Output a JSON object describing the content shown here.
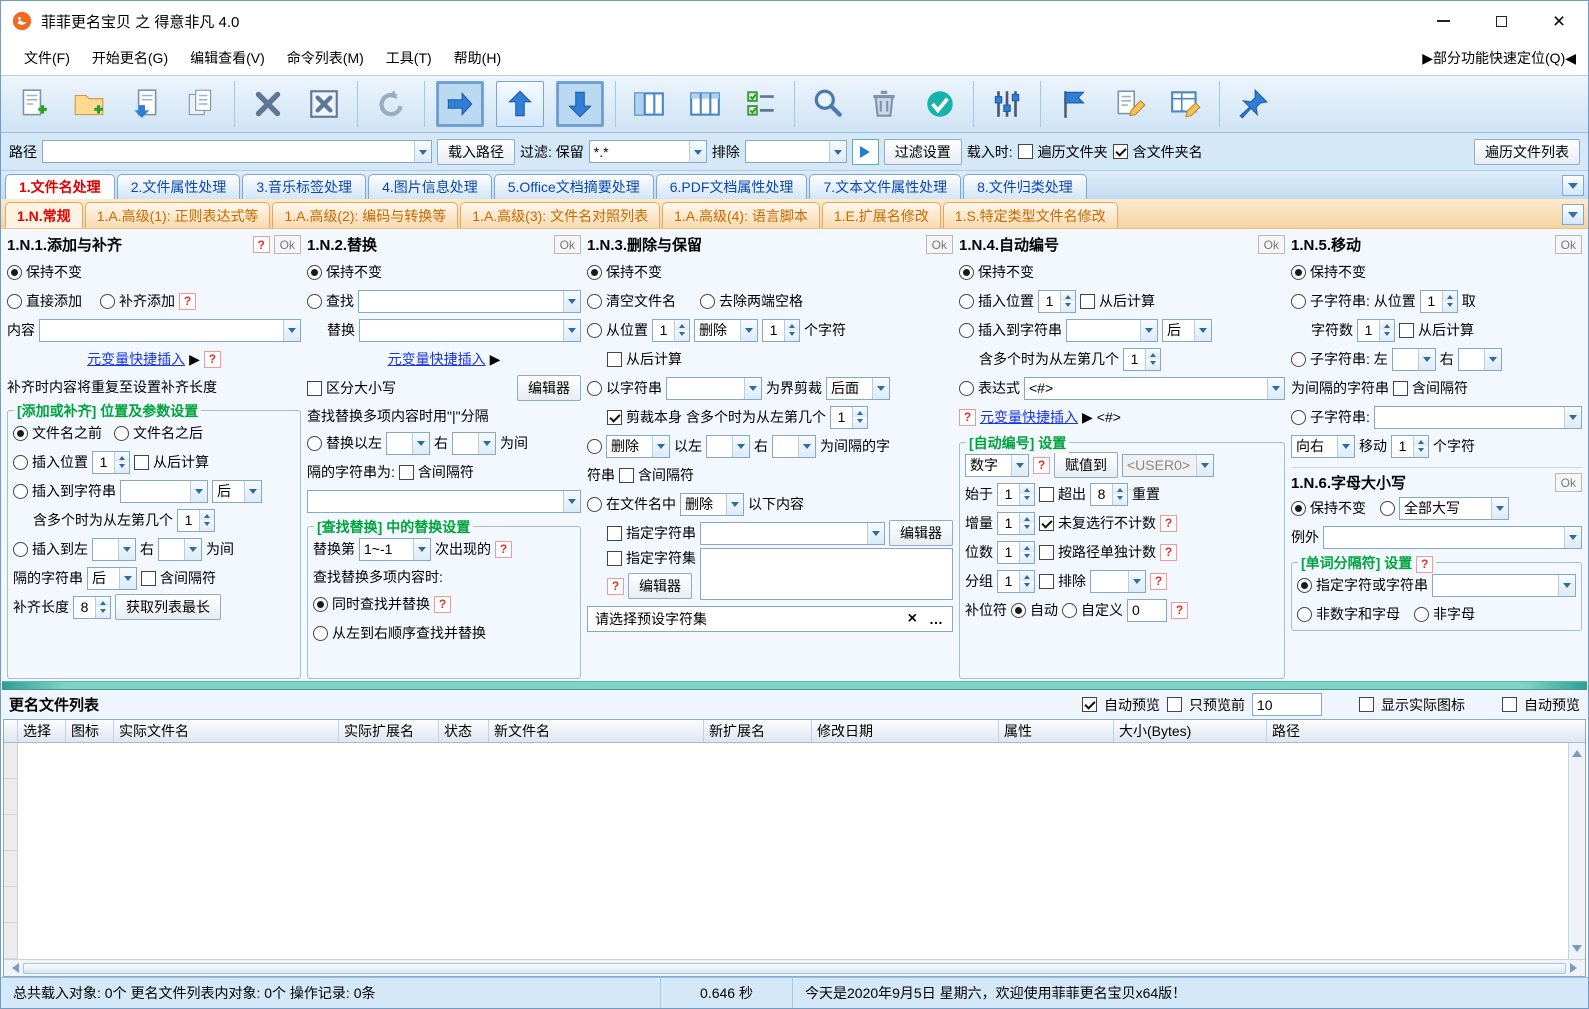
{
  "titlebar": {
    "title": "菲菲更名宝贝 之 得意非凡 4.0"
  },
  "menubar": {
    "items": [
      "文件(F)",
      "开始更名(G)",
      "编辑查看(V)",
      "命令列表(M)",
      "工具(T)",
      "帮助(H)"
    ],
    "quick": "▶部分功能快速定位(Q)◀"
  },
  "toolbar": {
    "icons": [
      "new-list-icon",
      "open-folder-icon",
      "load-list-icon",
      "save-list-icon",
      "clear-item-icon",
      "clear-list-icon",
      "undo-icon",
      "move-right-icon",
      "move-up-icon",
      "move-down-icon",
      "first-column-icon",
      "columns-icon",
      "check-list-icon",
      "preview-icon",
      "clear-filter-icon",
      "apply-icon",
      "adjust-icon",
      "flag-icon",
      "rename-icon",
      "edit-list-icon",
      "pin-icon"
    ]
  },
  "pathbar": {
    "path_label": "路径",
    "load_path": "载入路径",
    "filter_label": "过滤: 保留",
    "filter_value": "*.*",
    "exclude_label": "排除",
    "filter_settings": "过滤设置",
    "load_when": "载入时:",
    "traverse_folders": "遍历文件夹",
    "include_folder_name": "含文件夹名",
    "traverse_file_list": "遍历文件列表"
  },
  "tabs1": {
    "items": [
      "1.文件名处理",
      "2.文件属性处理",
      "3.音乐标签处理",
      "4.图片信息处理",
      "5.Office文档摘要处理",
      "6.PDF文档属性处理",
      "7.文本文件属性处理",
      "8.文件归类处理"
    ]
  },
  "tabs2": {
    "items": [
      "1.N.常规",
      "1.A.高级(1): 正则表达式等",
      "1.A.高级(2): 编码与转换等",
      "1.A.高级(3): 文件名对照列表",
      "1.A.高级(4): 语言脚本",
      "1.E.扩展名修改",
      "1.S.特定类型文件名修改"
    ]
  },
  "p1": {
    "title": "1.N.1.添加与补齐",
    "ok": "Ok",
    "q": "?",
    "keep": "保持不变",
    "direct": "直接添加",
    "pad": "补齐添加",
    "content_label": "内容",
    "meta_link": "元变量快捷插入",
    "arrow": "▶",
    "note": "补齐时内容将重复至设置补齐长度",
    "group": "[添加或补齐] 位置及参数设置",
    "before": "文件名之前",
    "after": "文件名之后",
    "insert_pos": "插入位置",
    "pos_val": "1",
    "from_end": "从后计算",
    "insert_to_str": "插入到字符串",
    "after_opt": "后",
    "multi_label": "含多个时为从左第几个",
    "multi_val": "1",
    "insert_left": "插入到左",
    "right_label": "右",
    "wei": "为间",
    "sep_label": "隔的字符串",
    "sep_opt": "后",
    "inc_sep": "含间隔符",
    "pad_len": "补齐长度",
    "pad_val": "8",
    "get_longest": "获取列表最长"
  },
  "p2": {
    "title": "1.N.2.替换",
    "ok": "Ok",
    "q": "?",
    "keep": "保持不变",
    "find": "查找",
    "replace": "替换",
    "meta_link": "元变量快捷插入",
    "arrow": "▶",
    "case_sensitive": "区分大小写",
    "editor": "编辑器",
    "note": "查找替换多项内容时用\"|\"分隔",
    "replace_left": "替换以左",
    "right_label": "右",
    "wei": "为间",
    "sep_label": "隔的字符串为:",
    "inc_sep": "含间隔符",
    "group": "[查找替换] 中的替换设置",
    "nth_label": "替换第",
    "nth_val": "1~-1",
    "nth_suffix": "次出现的",
    "multi_note": "查找替换多项内容时:",
    "simul": "同时查找并替换",
    "seq": "从左到右顺序查找并替换"
  },
  "p3": {
    "title": "1.N.3.删除与保留",
    "ok": "Ok",
    "q": "?",
    "keep": "保持不变",
    "clear_name": "清空文件名",
    "trim": "去除两端空格",
    "from_pos": "从位置",
    "v1": "1",
    "del": "删除",
    "v2": "1",
    "chars": "个字符",
    "from_end": "从后计算",
    "by_str": "以字符串",
    "cut": "为界剪裁",
    "side": "后面",
    "cut_self": "剪裁本身",
    "multi_label": "含多个时为从左第几个",
    "v3": "1",
    "left": "以左",
    "right": "右",
    "wei": "为间隔的字",
    "str2": "符串",
    "inc_sep": "含间隔符",
    "in_name": "在文件名中",
    "below": "以下内容",
    "spec_str": "指定字符串",
    "editor": "编辑器",
    "spec_set": "指定字符集",
    "preset": "请选择预设字符集",
    "clear_x": "×",
    "more": "…"
  },
  "p4": {
    "title": "1.N.4.自动编号",
    "ok": "Ok",
    "q": "?",
    "keep": "保持不变",
    "insert_pos": "插入位置",
    "v1": "1",
    "from_end": "从后计算",
    "insert_to_str": "插入到字符串",
    "after_opt": "后",
    "multi_label": "含多个时为从左第几个",
    "v2": "1",
    "expr": "表达式",
    "expr_val": "<#>",
    "meta_link": "元变量快捷插入",
    "arrow": "▶",
    "tag": "<#>",
    "group": "[自动编号] 设置",
    "numtype": "数字",
    "assign": "赋值到",
    "user": "<USER0>",
    "start": "始于",
    "v3": "1",
    "over": "超出",
    "v4": "8",
    "reset": "重置",
    "inc": "增量",
    "v5": "1",
    "skip": "未复选行不计数",
    "digits": "位数",
    "v6": "1",
    "by_path": "按路径单独计数",
    "group_n": "分组",
    "v7": "1",
    "exclude": "排除",
    "pad_char": "补位符",
    "auto": "自动",
    "custom": "自定义",
    "custom_val": "0"
  },
  "p5": {
    "title": "1.N.5.移动",
    "ok": "Ok",
    "keep": "保持不变",
    "sub_pos": "子字符串: 从位置",
    "v1": "1",
    "take": "取",
    "count": "字符数",
    "v2": "1",
    "from_end": "从后计算",
    "sub_lr": "子字符串: 左",
    "right": "右",
    "sep": "为间隔的字符串",
    "inc_sep": "含间隔符",
    "sub": "子字符串:",
    "dir": "向右",
    "move": "移动",
    "v3": "1",
    "chars": "个字符"
  },
  "p6": {
    "title": "1.N.6.字母大小写",
    "ok": "Ok",
    "q": "?",
    "keep": "保持不变",
    "allcase": "全部大写",
    "except": "例外",
    "group": "[单词分隔符] 设置",
    "spec": "指定字符或字符串",
    "non_alnum": "非数字和字母",
    "non_alpha": "非字母"
  },
  "listbar": {
    "title": "更名文件列表",
    "auto_preview": "自动预览",
    "preview_first": "只预览前",
    "preview_n": "10",
    "show_icons": "显示实际图标",
    "auto_preview2": "自动预览"
  },
  "table": {
    "cols": [
      "选择",
      "图标",
      "实际文件名",
      "实际扩展名",
      "状态",
      "新文件名",
      "新扩展名",
      "修改日期",
      "属性",
      "大小(Bytes)",
      "路径"
    ]
  },
  "status": {
    "left": "总共载入对象: 0个  更名文件列表内对象: 0个  操作记录: 0条",
    "time": "0.646 秒",
    "right": "今天是2020年9月5日 星期六，欢迎使用菲菲更名宝贝x64版！"
  }
}
